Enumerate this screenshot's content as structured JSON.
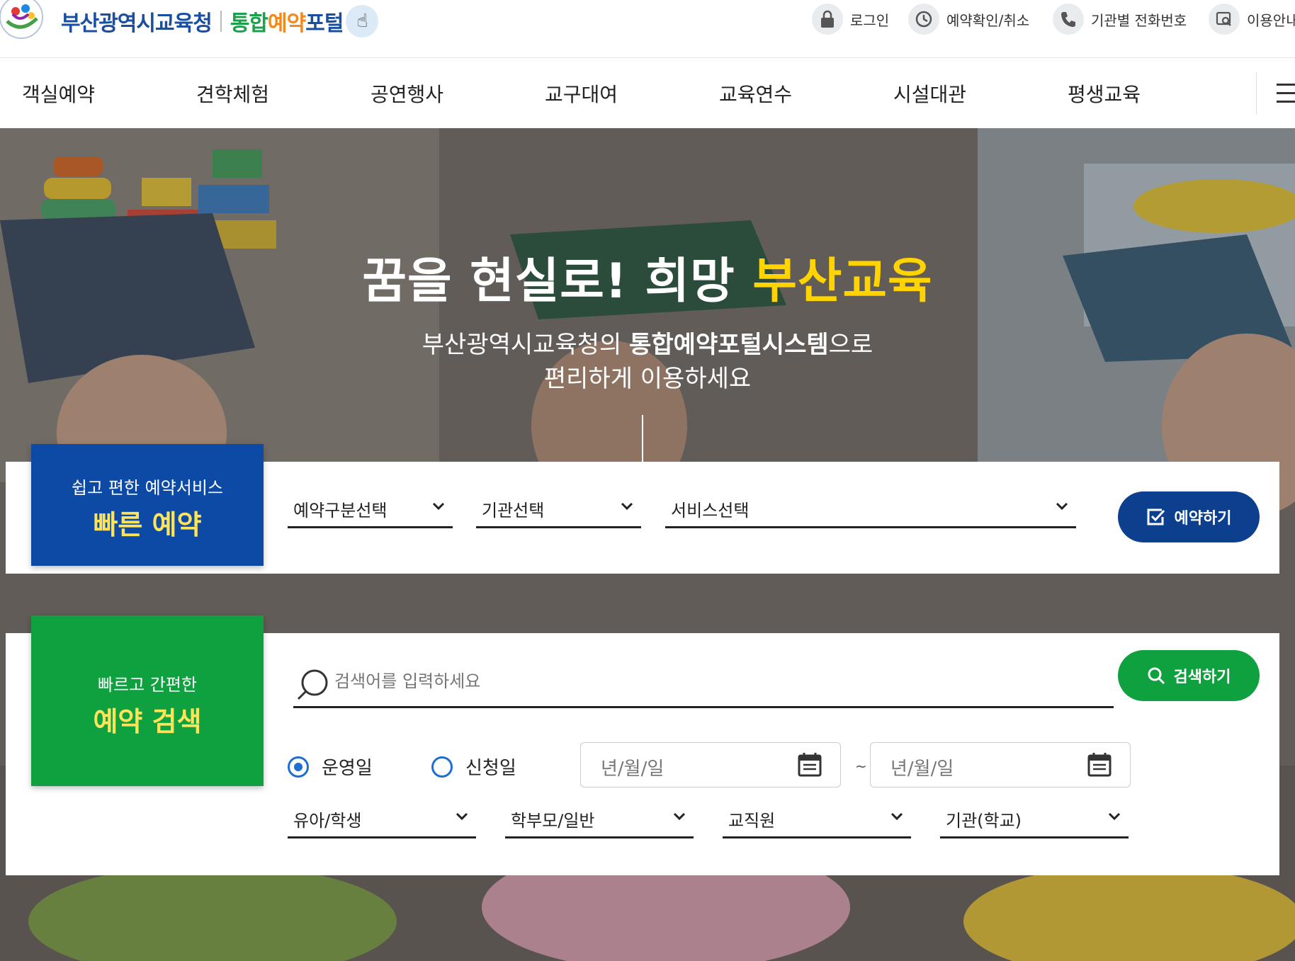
{
  "header": {
    "org_name": "부산광역시교육청",
    "portal_name_1": "통합",
    "portal_name_2": "예약",
    "portal_name_3": "포털",
    "util_links": [
      {
        "label": "로그인",
        "icon": "lock-icon"
      },
      {
        "label": "예약확인/취소",
        "icon": "clock-check-icon"
      },
      {
        "label": "기관별 전화번호",
        "icon": "phone-icon"
      },
      {
        "label": "이용안내",
        "icon": "guide-search-icon"
      }
    ]
  },
  "nav": {
    "items": [
      "객실예약",
      "견학체험",
      "공연행사",
      "교구대여",
      "교육연수",
      "시설대관",
      "평생교육"
    ]
  },
  "hero": {
    "title_main": "꿈을 현실로! 희망 ",
    "title_highlight": "부산교육",
    "sub_line1_prefix": "부산광역시교육청의 ",
    "sub_line1_bold": "통합예약포털시스템",
    "sub_line1_suffix": "으로",
    "sub_line2": "편리하게 이용하세요"
  },
  "quick_reserve": {
    "badge_small": "쉽고 편한 예약서비스",
    "badge_big": "빠른 예약",
    "selects": [
      "예약구분선택",
      "기관선택",
      "서비스선택"
    ],
    "button_label": "예약하기"
  },
  "quick_search": {
    "badge_small": "빠르고 간편한",
    "badge_big": "예약 검색",
    "search_placeholder": "검색어를 입력하세요",
    "button_label": "검색하기",
    "radio_options": [
      {
        "label": "운영일",
        "checked": true
      },
      {
        "label": "신청일",
        "checked": false
      }
    ],
    "date_from_placeholder": "년/월/일",
    "date_to_placeholder": "년/월/일",
    "range_separator": "~",
    "target_selects": [
      "유아/학생",
      "학부모/일반",
      "교직원",
      "기관(학교)"
    ]
  },
  "colors": {
    "primary_blue": "#0c4aa6",
    "button_navy": "#0d3f8f",
    "primary_green": "#0fa13f",
    "highlight_yellow": "#ffd400",
    "badge_text_yellow": "#ffe45a",
    "radio_blue": "#1f6fd1"
  }
}
